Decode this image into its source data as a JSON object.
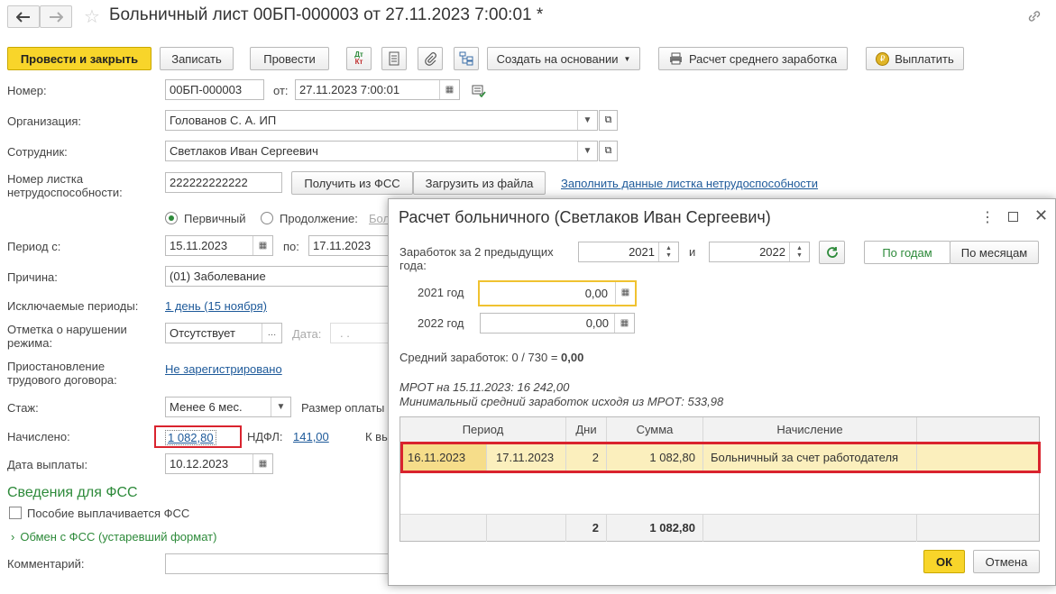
{
  "window": {
    "title": "Больничный лист 00БП-000003 от 27.11.2023 7:00:01 *"
  },
  "toolbar": {
    "post_close": "Провести и закрыть",
    "save": "Записать",
    "post": "Провести",
    "dtkt_top": "Дт",
    "dtkt_bottom": "Кт",
    "create_based": "Создать на основании",
    "avg_calc": "Расчет среднего заработка",
    "pay": "Выплатить"
  },
  "form": {
    "number_label": "Номер:",
    "number_value": "00БП-000003",
    "from_label": "от:",
    "date_value": "27.11.2023  7:00:01",
    "org_label": "Организация:",
    "org_value": "Голованов С. А. ИП",
    "employee_label": "Сотрудник:",
    "employee_value": "Светлаков Иван Сергеевич",
    "sheet_label": "Номер листка нетрудоспособности:",
    "sheet_value": "222222222222",
    "get_fss": "Получить из ФСС",
    "load_file": "Загрузить из файла",
    "fill_link": "Заполнить данные листка нетрудоспособности",
    "primary_label": "Первичный",
    "continuation_label": "Продолжение:",
    "continuation_value": "Бол",
    "period_label": "Период с:",
    "period_from": "15.11.2023",
    "period_to_label": "по:",
    "period_to": "17.11.2023",
    "reason_label": "Причина:",
    "reason_value": "(01) Заболевание",
    "excluded_label": "Исключаемые периоды:",
    "excluded_value": "1 день (15 ноября)",
    "violation_label": "Отметка о нарушении режима:",
    "violation_value": "Отсутствует",
    "violation_date_label": "Дата:",
    "violation_date_value": ". .",
    "suspension_label": "Приостановление трудового договора:",
    "suspension_value": "Не зарегистрировано",
    "experience_label": "Стаж:",
    "experience_value": "Менее 6 мес.",
    "pay_size_label": "Размер оплаты",
    "accrued_label": "Начислено:",
    "accrued_value": "1 082,80",
    "ndfl_label": "НДФЛ:",
    "ndfl_value": "141,00",
    "to_pay_label": "К вы",
    "pay_date_label": "Дата выплаты:",
    "pay_date_value": "10.12.2023",
    "fss_section": "Сведения для ФСС",
    "fss_benefit": "Пособие выплачивается ФСС",
    "fss_exchange": "Обмен с ФСС (устаревший формат)",
    "comment_label": "Комментарий:"
  },
  "dialog": {
    "title": "Расчет больничного (Светлаков Иван Сергеевич)",
    "earnings_label": "Заработок за 2 предыдущих года:",
    "year1": "2021",
    "and_label": "и",
    "year2": "2022",
    "by_years": "По годам",
    "by_months": "По месяцам",
    "year1_label": "2021 год",
    "year1_value": "0,00",
    "year2_label": "2022 год",
    "year2_value": "0,00",
    "avg_prefix": "Средний заработок: 0 / 730 = ",
    "avg_value": "0,00",
    "mrot_line": "МРОТ на 15.11.2023: 16 242,00",
    "min_avg_line": "Минимальный средний заработок исходя из МРОТ: 533,98",
    "table": {
      "headers": {
        "period": "Период",
        "days": "Дни",
        "sum": "Сумма",
        "accrual": "Начисление"
      },
      "rows": [
        {
          "from": "16.11.2023",
          "to": "17.11.2023",
          "days": "2",
          "sum": "1 082,80",
          "accrual": "Больничный за счет работодателя"
        }
      ],
      "footer": {
        "days": "2",
        "sum": "1 082,80"
      }
    },
    "ok": "ОК",
    "cancel": "Отмена"
  },
  "colors": {
    "primary": "#f8d52a",
    "highlight_border": "#d9232e",
    "row_bg": "#fbefbd",
    "link": "#1e5a9a",
    "section_green": "#2d8a3a"
  }
}
